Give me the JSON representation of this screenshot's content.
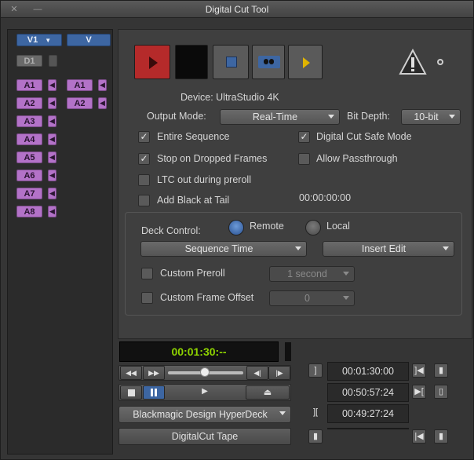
{
  "window": {
    "title": "Digital Cut Tool",
    "close_glyph": "✕",
    "minimize_glyph": "—"
  },
  "tracks": {
    "v1": "V1",
    "v": "V",
    "d1": "D1",
    "source": [
      "A1",
      "A2",
      "A3",
      "A4",
      "A5",
      "A6",
      "A7",
      "A8"
    ],
    "record": [
      "A1",
      "A2"
    ]
  },
  "device": {
    "label": "Device: UltraStudio 4K"
  },
  "output_mode": {
    "label": "Output Mode:",
    "value": "Real-Time"
  },
  "bit_depth": {
    "label": "Bit Depth:",
    "value": "10-bit"
  },
  "options": {
    "entire_sequence": {
      "label": "Entire Sequence",
      "checked": true
    },
    "digital_cut_safe_mode": {
      "label": "Digital Cut Safe Mode",
      "checked": true
    },
    "stop_on_dropped_frames": {
      "label": "Stop on Dropped Frames",
      "checked": true
    },
    "allow_passthrough": {
      "label": "Allow Passthrough",
      "checked": false
    },
    "ltc_out": {
      "label": "LTC out during preroll",
      "checked": false
    },
    "add_black": {
      "label": "Add Black at Tail",
      "checked": false
    },
    "black_tc": "00:00:00:00"
  },
  "deck": {
    "label": "Deck Control:",
    "remote": "Remote",
    "local": "Local",
    "time_source": "Sequence Time",
    "edit_mode": "Insert Edit",
    "custom_preroll": {
      "label": "Custom Preroll",
      "value": "1 second"
    },
    "custom_frame_offset": {
      "label": "Custom Frame Offset",
      "value": "0"
    }
  },
  "transport": {
    "timecode": "00:01:30:--",
    "deck_name": "Blackmagic Design HyperDeck",
    "tape": "DigitalCut Tape"
  },
  "marks": {
    "mark_in": "00:01:30:00",
    "mark_out": "00:50:57:24",
    "duration": "00:49:27:24"
  },
  "colors": {
    "record_red": "#b52a2a",
    "timecode_green": "#8fd400",
    "eject_yellow": "#e0b400"
  }
}
